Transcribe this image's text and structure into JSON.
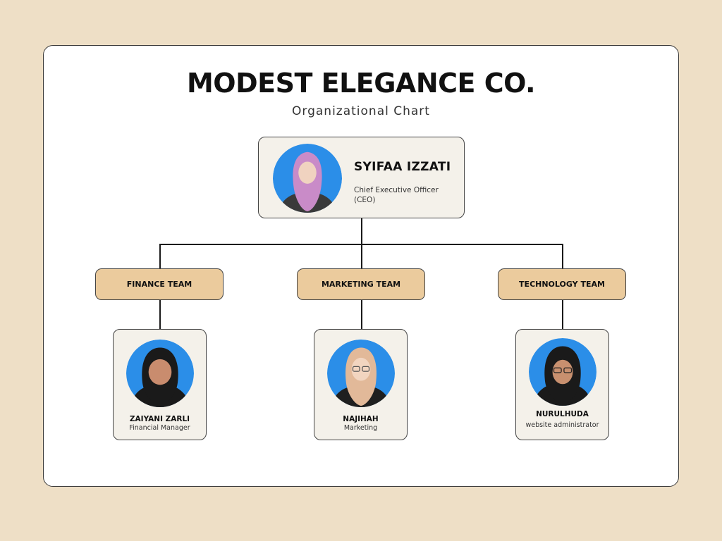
{
  "header": {
    "company": "MODEST ELEGANCE CO.",
    "subtitle": "Organizational Chart"
  },
  "ceo": {
    "name": "SYIFAA IZZATI",
    "role": "Chief Executive Officer (CEO)",
    "hijab_color": "#C98BC8"
  },
  "teams": [
    {
      "label": "FINANCE TEAM",
      "member": {
        "name": "ZAIYANI ZARLI",
        "role": "Financial Manager",
        "hijab_color": "#1A1A1A"
      }
    },
    {
      "label": "MARKETING TEAM",
      "member": {
        "name": "NAJIHAH",
        "role": "Marketing",
        "hijab_color": "#E2B999"
      }
    },
    {
      "label": "TECHNOLOGY TEAM",
      "member": {
        "name": "NURULHUDA",
        "role": "website administrator",
        "hijab_color": "#1A1A1A"
      }
    }
  ],
  "colors": {
    "background": "#EEDFC6",
    "card": "#FFFFFF",
    "box": "#F4F1EA",
    "team_pill": "#EBCB9D",
    "photo_bg": "#2B8EE8"
  }
}
